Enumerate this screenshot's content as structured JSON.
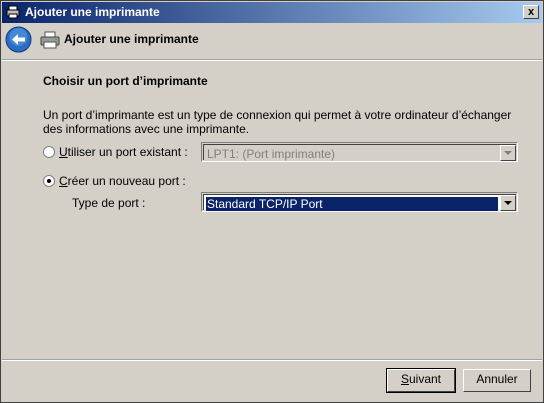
{
  "window": {
    "title": "Ajouter une imprimante",
    "close_label": "x"
  },
  "header": {
    "title": "Ajouter une imprimante"
  },
  "section": {
    "title": "Choisir un port d’imprimante",
    "description": "Un port d’imprimante est un type de connexion qui permet à votre ordinateur d’échanger des informations avec une imprimante."
  },
  "existing_port": {
    "label_accel": "U",
    "label_rest": "tiliser un port existant :",
    "value": "LPT1: (Port imprimante)",
    "checked": false,
    "enabled": false
  },
  "new_port": {
    "label_accel": "C",
    "label_rest": "réer un nouveau port :",
    "checked": true,
    "type_label": "Type de port :",
    "type_value": "Standard TCP/IP Port"
  },
  "buttons": {
    "next_accel": "S",
    "next_rest": "uivant",
    "cancel": "Annuler"
  },
  "colors": {
    "titlebar_start": "#0a246a",
    "titlebar_end": "#a6caf0",
    "face": "#d4d0c8",
    "selection": "#0a246a"
  }
}
